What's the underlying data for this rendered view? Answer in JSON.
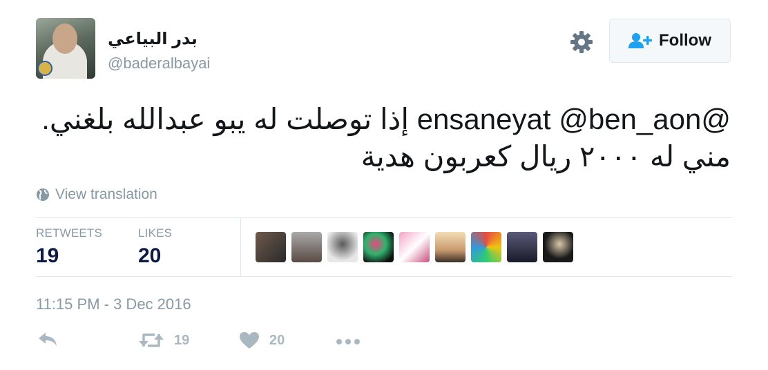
{
  "user": {
    "name": "بدر البياعي",
    "handle": "@baderalbayai"
  },
  "header": {
    "follow_label": "Follow",
    "settings_icon": "gear-icon",
    "follow_icon": "add-user-icon"
  },
  "tweet": {
    "mention_1": "@ensaneyat",
    "mention_2": "@ben_aon",
    "text_line1": "إذا توصلت له يبو عبدالله بلغني.",
    "text_line2": "مني له ٢٠٠٠ ريال كعربون هدية"
  },
  "translation": {
    "label": "View translation",
    "icon": "globe-icon"
  },
  "stats": {
    "retweets_label": "RETWEETS",
    "retweets_value": "19",
    "likes_label": "LIKES",
    "likes_value": "20"
  },
  "timestamp": "11:15 PM - 3 Dec 2016",
  "actions": {
    "reply_icon": "reply-icon",
    "retweet_icon": "retweet-icon",
    "retweet_count": "19",
    "like_icon": "heart-icon",
    "like_count": "20",
    "more_icon": "more-icon"
  },
  "colors": {
    "text": "#14171a",
    "muted": "#8899a6",
    "stat_value": "#0c1a46",
    "divider": "#e1e8ed",
    "follow_icon": "#1da1f2",
    "action_icon": "#aab8c2"
  }
}
